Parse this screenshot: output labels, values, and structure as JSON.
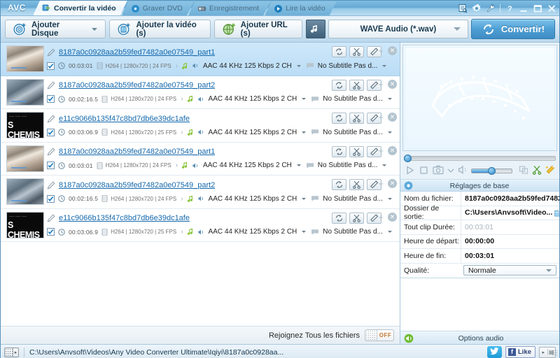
{
  "app": {
    "logo": "AVC"
  },
  "titlebar": {
    "tabs": [
      {
        "label": "Convertir la vidéo",
        "icon": "convert-video-icon",
        "active": true
      },
      {
        "label": "Graver DVD",
        "icon": "disc-icon",
        "active": false
      },
      {
        "label": "Enregistrement",
        "icon": "recorder-icon",
        "active": false
      },
      {
        "label": "Lire la vidéo",
        "icon": "play-icon",
        "active": false
      }
    ],
    "controls": [
      {
        "name": "log-icon",
        "glyph": "log"
      },
      {
        "name": "gear-icon",
        "glyph": "gear"
      },
      {
        "name": "wrench-icon",
        "glyph": "wrench"
      },
      {
        "name": "help-button",
        "glyph": "?"
      },
      {
        "name": "minimize-button",
        "glyph": "minimize"
      },
      {
        "name": "maximize-button",
        "glyph": "maximize"
      },
      {
        "name": "close-button",
        "glyph": "close"
      }
    ]
  },
  "toolbar": {
    "add_disc": "Ajouter Disque",
    "add_video": "Ajouter la vidéo (s)",
    "add_url": "Ajouter URL (s)",
    "format_selected": "WAVE Audio (*.wav)",
    "convert": "Convertir!"
  },
  "file_list": {
    "rows": [
      {
        "name": "8187a0c0928aa2b59fed7482a0e07549_part1",
        "duration": "00:03:01",
        "video": "H264 | 1280x720 | 24 FPS",
        "audio": "AAC 44 KHz 125 Kbps 2 CH",
        "subtitle": "No Subtitle Pas d...",
        "checked": true,
        "selected": true,
        "thumb": "a"
      },
      {
        "name": "8187a0c0928aa2b59fed7482a0e07549_part2",
        "duration": "00:02:16.5",
        "video": "H264 | 1280x720 | 24 FPS",
        "audio": "AAC 44 KHz 125 Kbps 2 CH",
        "subtitle": "No Subtitle Pas d...",
        "checked": true,
        "selected": false,
        "thumb": "b"
      },
      {
        "name": "e11c9066b135f47c8bd7db6e39dc1afe",
        "duration": "00:03:06.9",
        "video": "H264 | 1280x720 | 25 FPS",
        "audio": "AAC 44 KHz 125 Kbps 2 CH",
        "subtitle": "No Subtitle Pas d...",
        "checked": true,
        "selected": false,
        "thumb": "c"
      },
      {
        "name": "8187a0c0928aa2b59fed7482a0e07549_part1",
        "duration": "00:03:01",
        "video": "H264 | 1280x720 | 24 FPS",
        "audio": "AAC 44 KHz 125 Kbps 2 CH",
        "subtitle": "No Subtitle Pas d...",
        "checked": true,
        "selected": false,
        "thumb": "a"
      },
      {
        "name": "8187a0c0928aa2b59fed7482a0e07549_part2",
        "duration": "00:02:16.5",
        "video": "H264 | 1280x720 | 24 FPS",
        "audio": "AAC 44 KHz 125 Kbps 2 CH",
        "subtitle": "No Subtitle Pas d...",
        "checked": true,
        "selected": false,
        "thumb": "b"
      },
      {
        "name": "e11c9066b135f47c8bd7db6e39dc1afe",
        "duration": "00:03:06.9",
        "video": "H264 | 1280x720 | 25 FPS",
        "audio": "AAC 44 KHz 125 Kbps 2 CH",
        "subtitle": "No Subtitle Pas d...",
        "checked": true,
        "selected": false,
        "thumb": "c"
      }
    ],
    "thumb_poster_text": "S CHEMIS",
    "thumb_poster_sub": "—— —— ——"
  },
  "join_bar": {
    "label": "Rejoignez Tous les fichiers",
    "toggle_state": "OFF"
  },
  "preview": {
    "watermark": "film-strip-icon",
    "controls": [
      {
        "name": "play-button",
        "glyph": "play"
      },
      {
        "name": "stop-button",
        "glyph": "stop"
      },
      {
        "name": "snapshot-button",
        "glyph": "camera"
      },
      {
        "name": "snapshot-options-chevron-icon",
        "glyph": "chevron-down"
      },
      {
        "name": "volume-button",
        "glyph": "speaker"
      },
      {
        "name": "fullscreen-button",
        "glyph": "windows"
      },
      {
        "name": "cut-button",
        "glyph": "scissors"
      },
      {
        "name": "effects-button",
        "glyph": "wand"
      }
    ],
    "volume_percent": 43
  },
  "settings": {
    "header": "Réglages de base",
    "header_icon": "gear-blue-icon",
    "rows": [
      {
        "key": "Nom du fichier:",
        "value": "8187a0c0928aa2b59fed7482...",
        "dim": false,
        "folder": false
      },
      {
        "key": "Dossier de sortie:",
        "value": "C:\\Users\\Anvsoft\\Video...",
        "dim": false,
        "folder": true
      },
      {
        "key": "Tout clip Durée:",
        "value": "00:03:01",
        "dim": true,
        "folder": false
      },
      {
        "key": "Heure de départ:",
        "value": "00:00:00",
        "dim": false,
        "folder": false
      },
      {
        "key": "Heure de fin:",
        "value": "00:03:01",
        "dim": false,
        "folder": false
      }
    ],
    "quality_key": "Qualité:",
    "quality_value": "Normale"
  },
  "audio_options": {
    "label": "Options audio",
    "icon": "speaker-green-icon"
  },
  "statusbar": {
    "toggle_glyph": "▸",
    "path": "C:\\Users\\Anvsoft\\Videos\\Any Video Converter Ultimate\\Iqiyi\\8187a0c0928aa...",
    "twitter": "twitter-icon",
    "facebook_f": "f",
    "facebook_like": "Like",
    "grip_a": "▸",
    "grip_b": "▤"
  },
  "colors": {
    "accent_blue": "#3f8cc4",
    "link_blue": "#1569ad",
    "selected_row": "#c4e2f7",
    "toggle_off_text": "#c2762e",
    "facebook_blue": "#3b5998",
    "twitter_blue": "#1f9ad6"
  }
}
